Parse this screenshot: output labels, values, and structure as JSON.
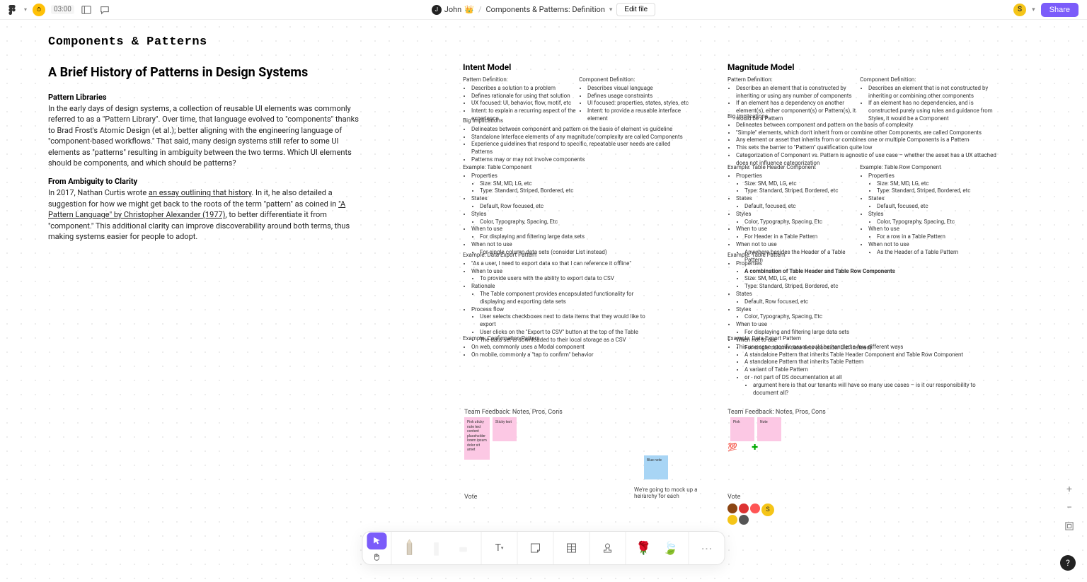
{
  "topbar": {
    "timer": "03:00",
    "user_name": "John",
    "file_name": "Components & Patterns: Definition",
    "edit_label": "Edit file",
    "share_label": "Share",
    "right_avatar": "S"
  },
  "page_title": "Components & Patterns",
  "essay": {
    "heading": "A Brief History of Patterns in Design Systems",
    "sec1_title": "Pattern Libraries",
    "sec1_body_a": "In the early days of design systems, a collection of reusable UI elements was commonly referred to as a \"Pattern Library\". Over time, that language evolved to \"components\" thanks to Brad Frost's Atomic Design (et al.); better aligning with the engineering language of \"component-based workflows.\" That said, many design systems still refer to some UI elements as \"patterns\" resulting in ambiguity between the two terms. Which UI elements should be components, and which should be patterns?",
    "sec2_title": "From Ambiguity to Clarity",
    "sec2_a": "In 2017, Nathan Curtis wrote ",
    "sec2_link1": "an essay outlining that history",
    "sec2_b": ". In it, he also detailed a suggestion for how we might get back to the roots of the term \"pattern\" as coined in ",
    "sec2_link2": "\"A Pattern Language\" by Christopher Alexander (1977)",
    "sec2_c": ", to better differentiate it from \"component.\" This additional clarity can improve discoverability around both terms, thus making systems easier for people to adopt."
  },
  "intent": {
    "title": "Intent Model",
    "pattern_def_label": "Pattern Definition:",
    "pattern_def": [
      "Describes a solution to a problem",
      "Defines rationale for using that solution",
      "UX focused: UI, behavior, flow, motif, etc",
      "Intent: to explain a recurring aspect of the experience"
    ],
    "component_def_label": "Component Definition:",
    "component_def": [
      "Describes visual language",
      "Defines usage constraints",
      "UI focused: properties, states, styles, etc",
      "Intent: to provide a reusable interface element"
    ],
    "impl_label": "Big implications",
    "impl": [
      "Delineates between component and pattern on the basis of element vs guideline",
      "Standalone Interface elements of any magnitude/complexity are called Components",
      "Experience guidelines that respond to specific, repeatable user needs are called Patterns",
      "Patterns may or may not involve components"
    ],
    "ex1_label": "Example: Table Component",
    "ex1_props_label": "Properties",
    "ex1_props": [
      "Size: SM, MD, LG, etc",
      "Type: Standard, Striped, Bordered, etc"
    ],
    "ex1_states_label": "States",
    "ex1_states": [
      "Default, Row focused, etc"
    ],
    "ex1_styles_label": "Styles",
    "ex1_styles": [
      "Color, Typography, Spacing, Etc"
    ],
    "ex1_when_label": "When to use",
    "ex1_when": [
      "For displaying and filtering large data sets"
    ],
    "ex1_not_label": "When not to use",
    "ex1_not": [
      "For single column data sets (consider List instead)"
    ],
    "ex2_label": "Example: Data Export Pattern",
    "ex2_quote": "\"As a user, I need to export data so that I can reference it offline\"",
    "ex2_when_label": "When to use",
    "ex2_when": [
      "To provide users with the ability to export data to CSV"
    ],
    "ex2_rationale_label": "Rationale",
    "ex2_rationale": [
      "The Table component provides encapsulated functionality for displaying and exporting data sets"
    ],
    "ex2_flow_label": "Process flow",
    "ex2_flow": [
      "User selects checkboxes next to data items that they would like to export",
      "User clicks on the \"Export to CSV\" button at the top of the Table",
      "The data set is downloaded to their local storage as a CSV"
    ],
    "ex3_label": "Example: Confirmation Pattern",
    "ex3": [
      "On web, commonly uses a Modal component",
      "On mobile, commonly a \"tap to confirm\" behavior"
    ],
    "feedback_label": "Team Feedback: Notes, Pros, Cons",
    "vote_label": "Vote",
    "hierarchy_caption": "We're going to mock up a heirarchy for each"
  },
  "magnitude": {
    "title": "Magnitude Model",
    "pattern_def_label": "Pattern Definition:",
    "pattern_def": [
      "Describes an element that is constructed by inheriting or using any number of components",
      "If an element has a dependency on another element(s), either component(s) or Pattern(s), it would be a Pattern"
    ],
    "component_def_label": "Component Definition:",
    "component_def": [
      "Describes an element that is not constructed by inheriting or combining other components",
      "If an element has no dependencies, and is constructed purely using rules and guidance from Styles, it would be a Component"
    ],
    "impl_label": "Big implications",
    "impl": [
      "Delineates between component and pattern on the basis of complexity",
      "\"Simple\" elements, which don't inherit from or combine other Components, are called Components",
      "Any element or asset that inherits from or combines one or multiple Components is a Pattern",
      "This sets the barrier to \"Pattern\" qualification quite low",
      "Categorization of Component vs. Pattern is agnostic of use case – whether the asset has a UX attached does not influence categorization"
    ],
    "exh_label": "Example: Table Header Component",
    "exr_label": "Example: Table Row Component",
    "ex_props_label": "Properties",
    "ex_props": [
      "Size: SM, MD, LG, etc",
      "Type: Standard, Striped, Bordered, etc"
    ],
    "ex_states_label": "States",
    "ex_states": [
      "Default, focused, etc"
    ],
    "ex_styles_label": "Styles",
    "ex_styles": [
      "Color, Typography, Spacing, Etc"
    ],
    "ex_when_label": "When to use",
    "exh_when": [
      "For Header in a Table Pattern"
    ],
    "exr_when": [
      "For a row in a Table Pattern"
    ],
    "ex_not_label": "When not to use",
    "exh_not": [
      "Anywhere besides the Header of a Table Pattern"
    ],
    "exr_not": [
      "As the Header of a Table Pattern"
    ],
    "tp_label": "Example: Table Pattern",
    "tp_props_label": "Properties",
    "tp_combo": "A combination of Table Header and Table Row Components",
    "tp_props": [
      "Size: SM, MD, LG, etc",
      "Type: Standard, Striped, Bordered, etc"
    ],
    "tp_states_label": "States",
    "tp_states": [
      "Default, Row focused, etc"
    ],
    "tp_styles_label": "Styles",
    "tp_styles": [
      "Color, Typography, Spacing, Etc"
    ],
    "tp_when_label": "When to use",
    "tp_when": [
      "For displaying and filtering large data sets"
    ],
    "tp_not_label": "When not to use",
    "tp_not": [
      "For single column data sets (consider List instead)"
    ],
    "de_label": "Example: Data Export Pattern",
    "de": [
      "This use-case specific asset could be handled a few different ways",
      "A standalone Pattern that inherits Table Header Component and Table Row Component",
      "A standalone Pattern that inherits Table Pattern",
      "A variant of Table Pattern",
      "or - not part of DS documentation at all"
    ],
    "de_arg": "argument here is that our tenants will have so many use cases – is it our responsibility to document all?",
    "feedback_label": "Team Feedback: Notes, Pros, Cons",
    "vote_label": "Vote"
  }
}
